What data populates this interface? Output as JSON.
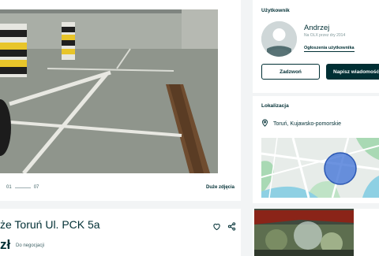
{
  "gallery": {
    "photo_counter_current": "01",
    "photo_counter_total": "07",
    "big_photos_label": "Duże zdjęcia"
  },
  "ad": {
    "title": "że Toruń Ul. PCK 5a",
    "price": "zł",
    "negotiation_label": "Do negocjacji"
  },
  "user": {
    "section_label": "Użytkownik",
    "name": "Andrzej",
    "since": "Na OLX przez dry 2014",
    "ads_link": "Ogłoszenia użytkownika",
    "call_label": "Zadzwoń",
    "message_label": "Napisz wiadomość"
  },
  "location": {
    "section_label": "Lokalizacja",
    "place": "Toruń, Kujawsko-pomorskie"
  },
  "colors": {
    "brand_dark": "#002f34",
    "map_marker": "#3b6fd6"
  }
}
